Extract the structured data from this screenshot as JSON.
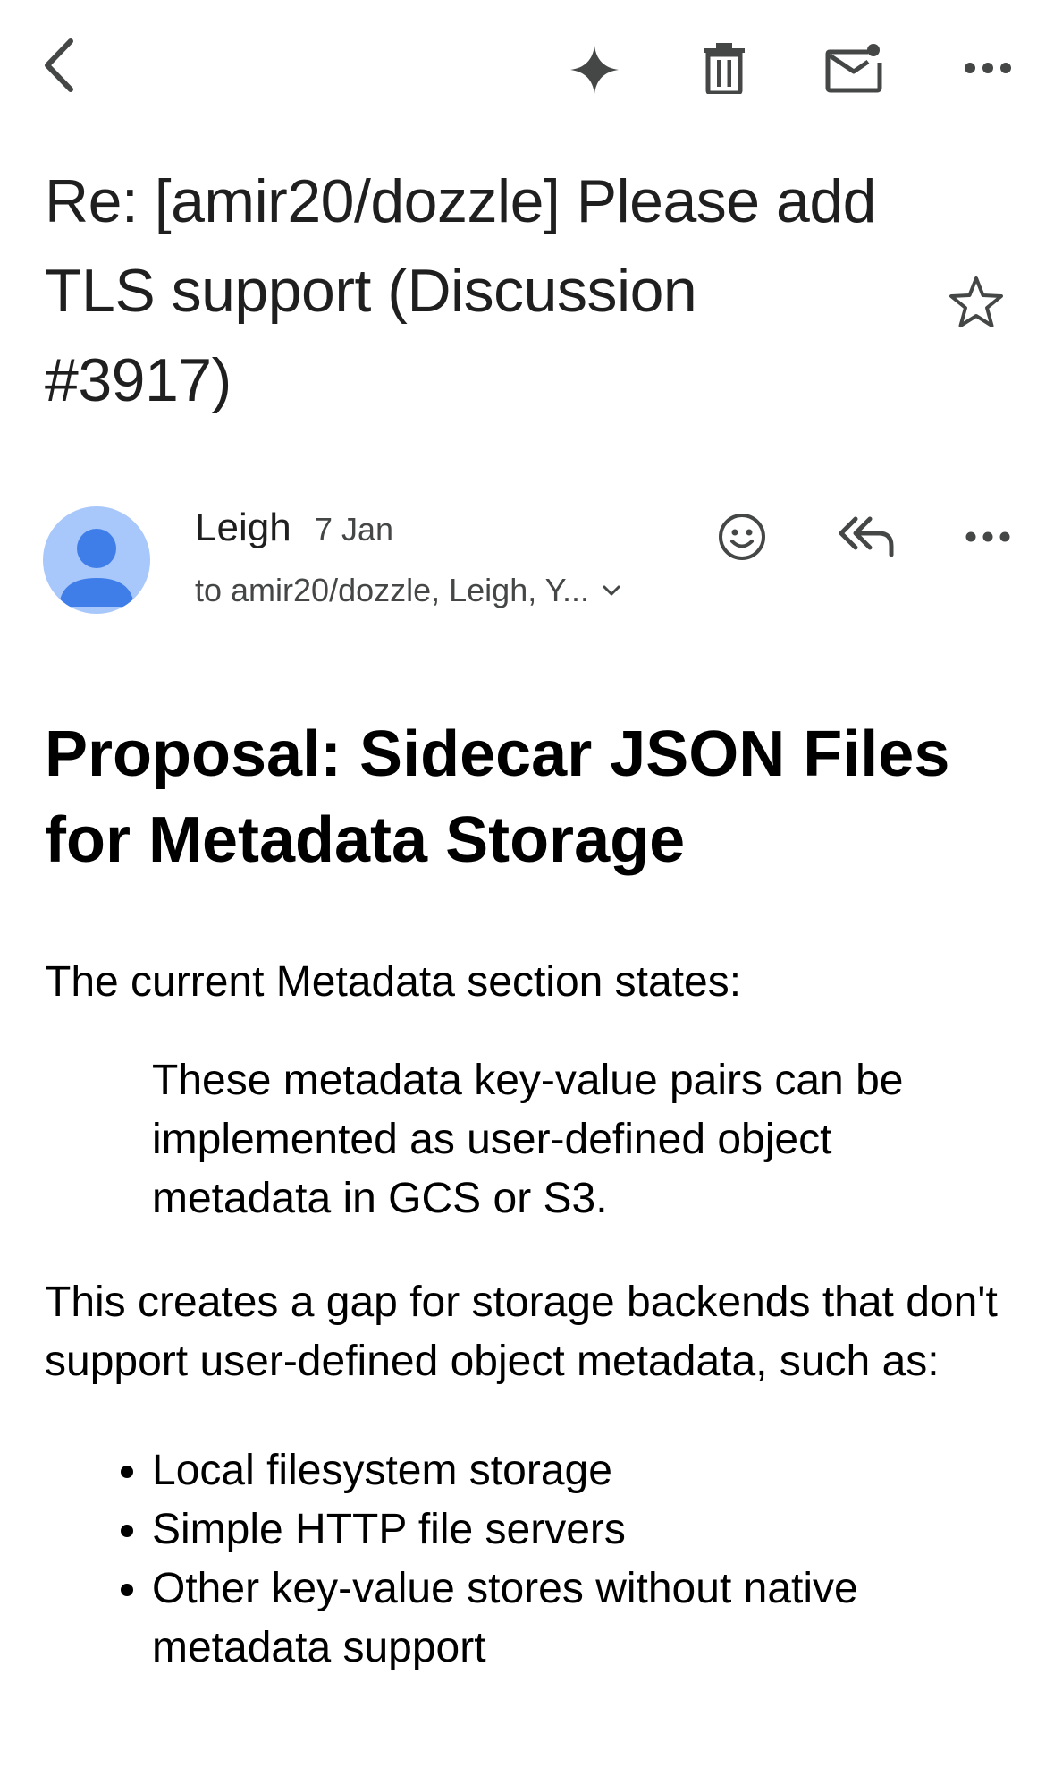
{
  "toolbar": {
    "back_icon": "chevron-left-icon",
    "ai_icon": "sparkle-icon",
    "delete_icon": "trash-icon",
    "unread_icon": "mark-unread-icon",
    "more_icon": "more-horizontal-icon"
  },
  "email": {
    "subject_line1": "Re: [amir20/dozzle] Please add",
    "subject_line2": "TLS support (Discussion",
    "subject_line3": "#3917)",
    "starred": false,
    "sender": {
      "name": "Leigh",
      "date": "7 Jan",
      "recipients": "to amir20/dozzle, Leigh, Y...",
      "avatar_color": "#a8c7fa",
      "avatar_figure_color": "#3f7ee8"
    }
  },
  "body": {
    "heading": "Proposal: Sidecar JSON Files for Metadata Storage",
    "intro": "The current Metadata section states:",
    "quote": "These metadata key-value pairs can be implemented as user-defined object metadata in GCS or S3.",
    "gap_text": "This creates a gap for storage backends that don't support user-defined object metadata, such as:",
    "bullets": [
      "Local filesystem storage",
      "Simple HTTP file servers",
      "Other key-value stores without native metadata support"
    ]
  }
}
